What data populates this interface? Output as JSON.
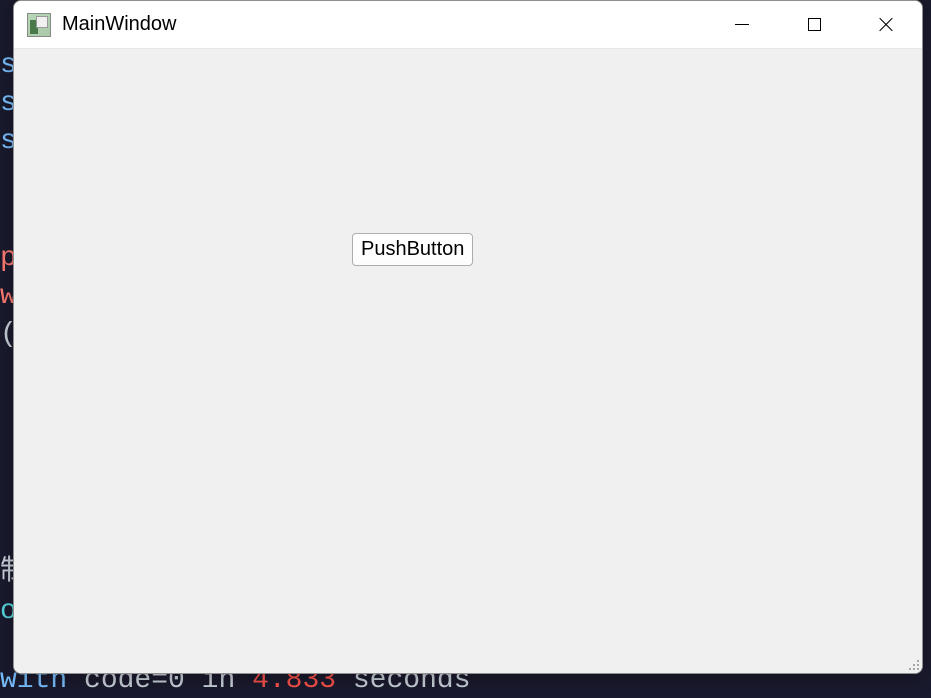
{
  "window": {
    "title": "MainWindow"
  },
  "button": {
    "label": "PushButton"
  },
  "background": {
    "line1": "s",
    "line2": "s",
    "line3": "s",
    "line4": "p",
    "line5": "w",
    "line6": "(",
    "line7": "制",
    "line8": "o",
    "line9a": "with",
    "line9b": " code=0 in ",
    "line9c": "4.833",
    "line9d": " seconds"
  }
}
